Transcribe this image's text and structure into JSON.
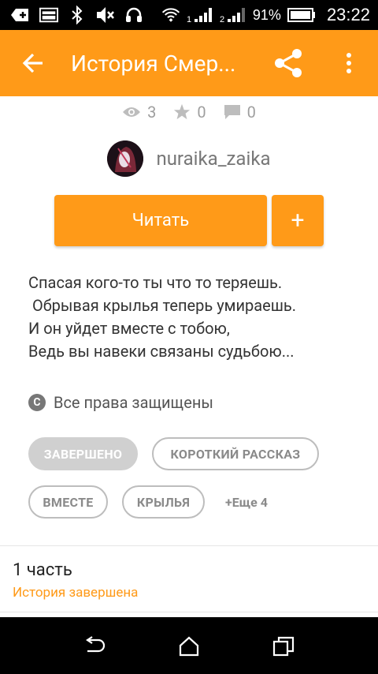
{
  "status_bar": {
    "battery_percent": "91%",
    "time": "23:22",
    "signal_1_label": "1",
    "signal_2_label": "2"
  },
  "app_bar": {
    "title": "История Смер...",
    "back_icon": "arrow-left-icon",
    "share_icon": "share-icon",
    "more_icon": "more-vert-icon"
  },
  "stats": {
    "views": "3",
    "stars": "0",
    "comments": "0"
  },
  "author": {
    "name": "nuraika_zaika"
  },
  "actions": {
    "read_label": "Читать",
    "add_label": "+"
  },
  "description": [
    "Спасая кого-то ты что то теряешь.",
    " Обрывая крылья теперь умираешь.",
    "И он уйдет вместе с тобою,",
    "Ведь вы навеки связаны судьбою..."
  ],
  "copyright": {
    "text": "Все права защищены"
  },
  "tags": [
    {
      "label": "ЗАВЕРШЕНО",
      "filled": true
    },
    {
      "label": "КОРОТКИЙ РАССКАЗ",
      "filled": false
    },
    {
      "label": "ВМЕСТЕ",
      "filled": false
    },
    {
      "label": "КРЫЛЬЯ",
      "filled": false
    }
  ],
  "more_tags": "+Еще 4",
  "parts": {
    "title": "1 часть",
    "status": "История завершена"
  },
  "colors": {
    "accent": "#FF9A18"
  }
}
